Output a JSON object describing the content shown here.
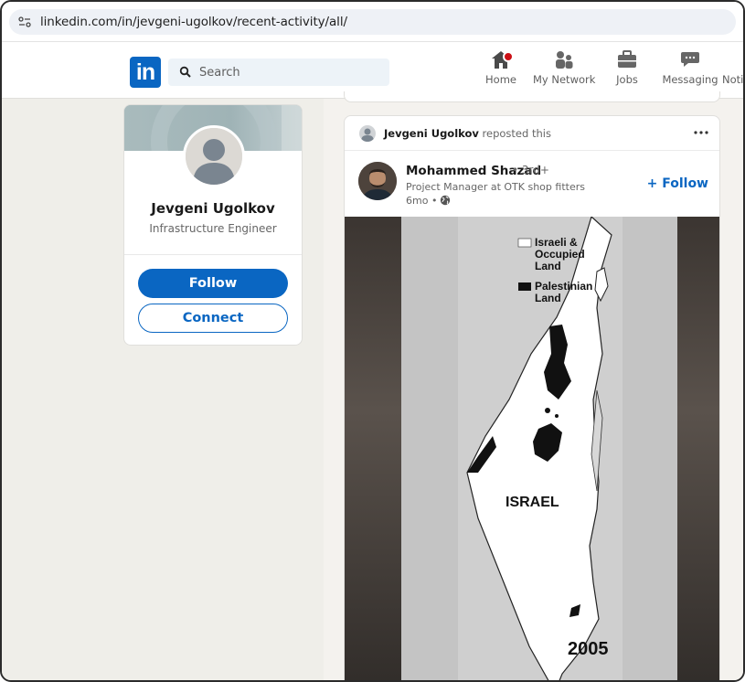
{
  "browser": {
    "url": "linkedin.com/in/jevgeni-ugolkov/recent-activity/all/"
  },
  "nav": {
    "logo": "in",
    "search_placeholder": "Search",
    "items": [
      {
        "label": "Home"
      },
      {
        "label": "My Network"
      },
      {
        "label": "Jobs"
      },
      {
        "label": "Messaging"
      },
      {
        "label": "Noti"
      }
    ]
  },
  "profile": {
    "name": "Jevgeni Ugolkov",
    "title": "Infrastructure Engineer",
    "follow_label": "Follow",
    "connect_label": "Connect"
  },
  "post": {
    "reposter": "Jevgeni Ugolkov",
    "repost_suffix": "reposted this",
    "author": "Mohammed Shazad",
    "degree": "• 3rd+",
    "headline": "Project Manager at OTK shop fitters",
    "time": "6mo •",
    "follow_label": "+ Follow",
    "video": {
      "legend_1_line1": "Israeli &",
      "legend_1_line2": "Occupied",
      "legend_1_line3": "Land",
      "legend_2_line1": "Palestinian",
      "legend_2_line2": "Land",
      "map_label": "ISRAEL",
      "year": "2005",
      "colors": {
        "israeli": "#ffffff",
        "palestinian": "#111111"
      }
    }
  },
  "colors": {
    "brand": "#0a66c2",
    "notification": "#cc1016"
  }
}
